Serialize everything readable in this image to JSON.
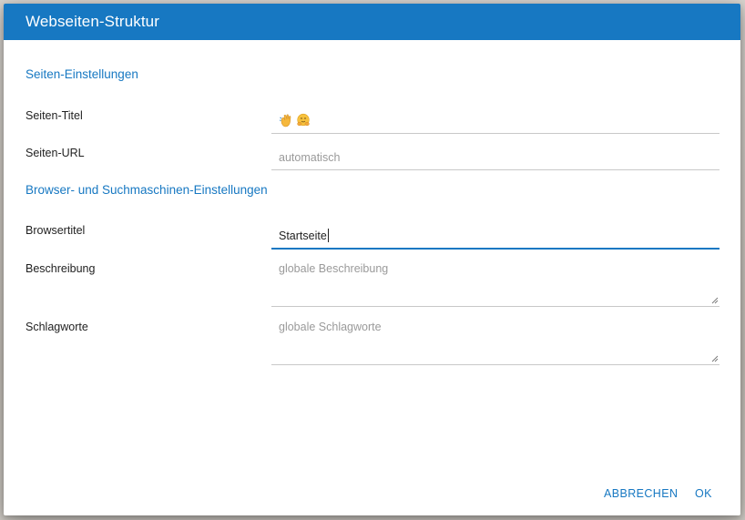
{
  "dialog": {
    "title": "Webseiten-Struktur"
  },
  "sections": {
    "page_settings": "Seiten-Einstellungen",
    "browser_settings": "Browser- und Suchmaschinen-Einstellungen"
  },
  "fields": {
    "page_title": {
      "label": "Seiten-Titel",
      "emojis": [
        "waving-hand-icon",
        "hugging-face-icon"
      ]
    },
    "page_url": {
      "label": "Seiten-URL",
      "placeholder": "automatisch"
    },
    "browser_title": {
      "label": "Browsertitel",
      "value": "Startseite"
    },
    "description": {
      "label": "Beschreibung",
      "placeholder": "globale Beschreibung"
    },
    "keywords": {
      "label": "Schlagworte",
      "placeholder": "globale Schlagworte"
    }
  },
  "buttons": {
    "cancel": "ABBRECHEN",
    "ok": "OK"
  },
  "colors": {
    "accent": "#1778c2",
    "header_text": "#ffffff"
  }
}
